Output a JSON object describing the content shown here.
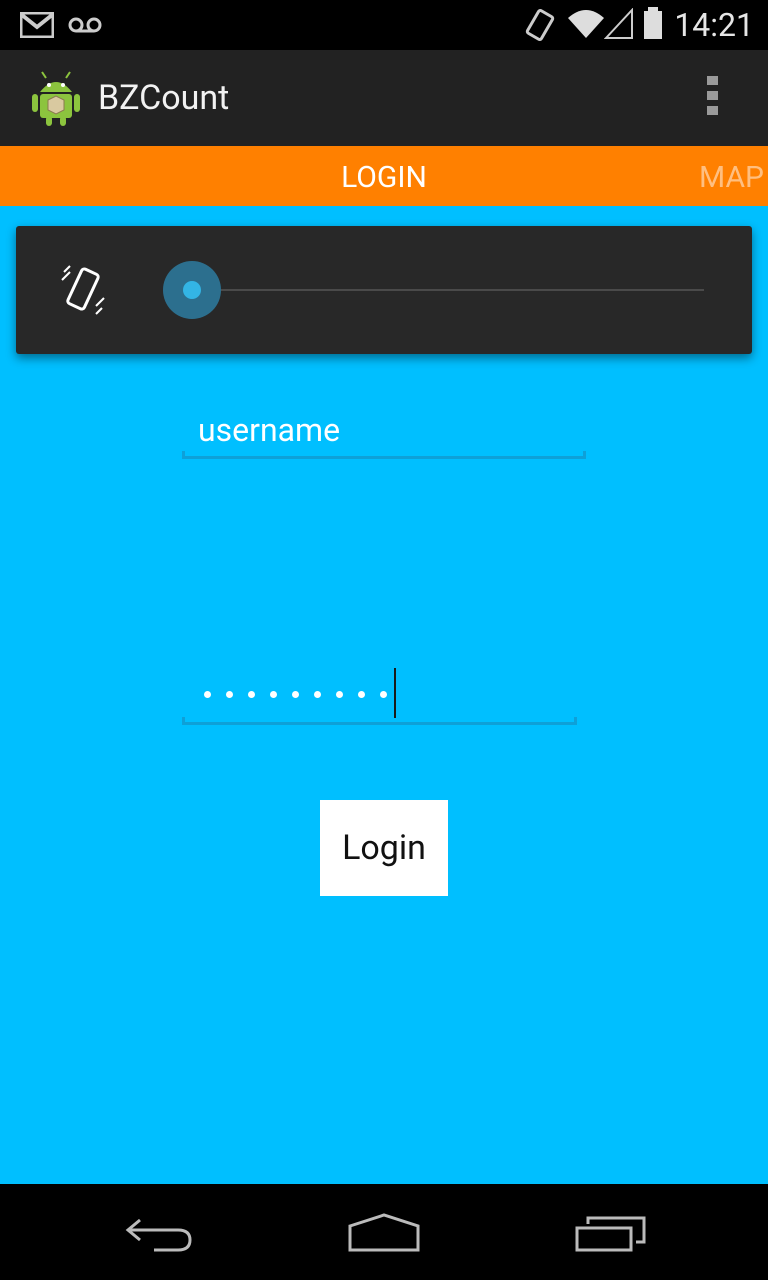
{
  "status_bar": {
    "time": "14:21",
    "icons": [
      "gmail-icon",
      "voicemail-icon",
      "vibrate-icon",
      "wifi-icon",
      "signal-icon",
      "battery-icon"
    ]
  },
  "action_bar": {
    "title": "BZCount",
    "app_icon": "android-robot-icon",
    "overflow_icon": "overflow-menu-icon"
  },
  "tabs": [
    {
      "label": "LOGIN",
      "selected": true
    },
    {
      "label": "MAP",
      "selected": false
    }
  ],
  "volume_panel": {
    "icon": "vibrate-icon",
    "level": 0
  },
  "form": {
    "username_value": "username",
    "password_masked_length": 9,
    "login_button_label": "Login"
  },
  "nav_bar": {
    "buttons": [
      "back-icon",
      "home-icon",
      "recents-icon"
    ]
  },
  "colors": {
    "background": "#00bfff",
    "tab_strip": "#ff8000",
    "action_bar": "#222222",
    "slider_accent": "#33b5e5"
  }
}
